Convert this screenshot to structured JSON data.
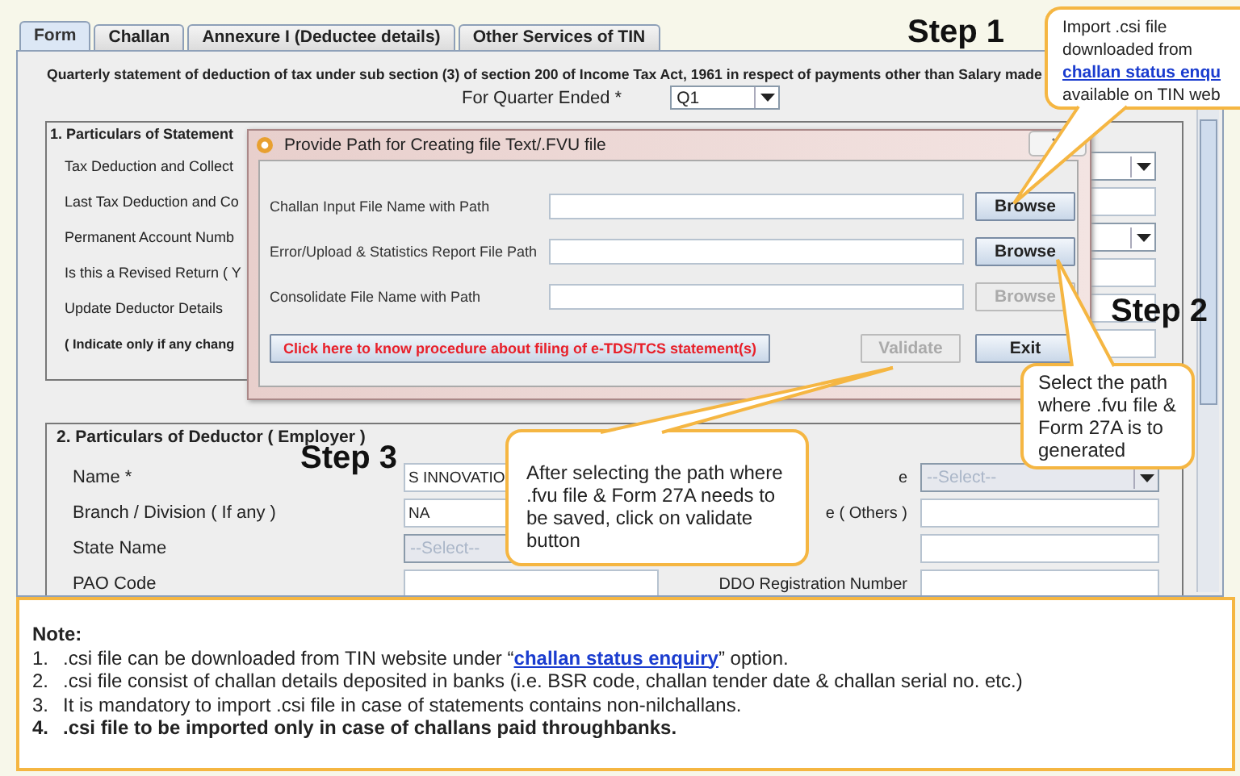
{
  "tabs": [
    {
      "label": "Form",
      "selected": true
    },
    {
      "label": "Challan",
      "selected": false
    },
    {
      "label": "Annexure I (Deductee details)",
      "selected": false
    },
    {
      "label": "Other Services of TIN",
      "selected": false
    }
  ],
  "form": {
    "heading": "Quarterly statement of deduction of tax under sub section (3) of section 200 of Income Tax Act, 1961 in respect of payments other than Salary made",
    "quarter_label": "For Quarter Ended *",
    "quarter_value": "Q1",
    "section_1": {
      "title": "1. Particulars of Statement",
      "rows": [
        {
          "label": "Tax Deduction and Collect",
          "bold": false,
          "kind": "dropdown"
        },
        {
          "label": "Last Tax Deduction and Co",
          "bold": false,
          "kind": "text"
        },
        {
          "label": "Permanent Account Numb",
          "bold": false,
          "kind": "dropdown"
        },
        {
          "label": "Is this a Revised Return ( Y",
          "bold": false,
          "kind": "text"
        },
        {
          "label": "Update Deductor Details",
          "bold": false,
          "kind": "text"
        },
        {
          "label": "( Indicate only if any chang",
          "bold": true,
          "kind": "text"
        }
      ]
    },
    "section_2": {
      "title": "2. Particulars of Deductor ( Employer )",
      "rows": [
        {
          "label": "Name *",
          "field": {
            "kind": "text",
            "value": "S INNOVATIO",
            "disabled": false
          },
          "right_label": "e",
          "right_field": {
            "kind": "dropdown",
            "value": "--Select--",
            "disabled": true
          }
        },
        {
          "label": "Branch / Division ( If any )",
          "field": {
            "kind": "text",
            "value": "NA",
            "disabled": false
          },
          "right_label": "e ( Others )",
          "right_field": {
            "kind": "text",
            "disabled": false
          }
        },
        {
          "label": "State Name",
          "field": {
            "kind": "dropdown",
            "value": "--Select--",
            "disabled": true
          },
          "right_field": {
            "kind": "text",
            "disabled": false
          }
        },
        {
          "label": "PAO Code",
          "field": {
            "kind": "text",
            "disabled": false
          },
          "right_label": "DDO Registration Number",
          "right_field": {
            "kind": "text",
            "disabled": false
          }
        }
      ]
    }
  },
  "dialog": {
    "title": "Provide Path for Creating file Text/.FVU file",
    "rows": [
      {
        "label": "Challan Input File Name with Path",
        "button": "Browse",
        "disabled": false
      },
      {
        "label": "Error/Upload & Statistics Report File Path",
        "button": "Browse",
        "disabled": false
      },
      {
        "label": "Consolidate File Name with Path",
        "button": "Browse",
        "disabled": true
      }
    ],
    "procedure_button": "Click here to know procedure about filing of e-TDS/TCS statement(s)",
    "validate": {
      "label": "Validate",
      "disabled": true
    },
    "exit": {
      "label": "Exit",
      "disabled": false
    }
  },
  "steps": [
    "Step 1",
    "Step 2",
    "Step 3"
  ],
  "callouts": [
    {
      "text": "Import .csi file downloaded from",
      "link": "challan status enqu",
      "text_after": "available on TIN web"
    },
    {
      "text": "Select the path where .fvu file & Form 27A is to generated"
    },
    {
      "text": "After selecting the path where .fvu file & Form 27A needs to be saved, click on validate button"
    }
  ],
  "note": {
    "title": "Note:",
    "items": [
      {
        "number": "1.",
        "text": ".csi file can be downloaded from TIN website under “",
        "link": "challan status enquiry",
        "text_after": "” option.",
        "bold": false
      },
      {
        "number": "2.",
        "text": ".csi file consist of challan details deposited in banks (i.e. BSR code, challan tender date & challan serial no. etc.)",
        "bold": false
      },
      {
        "number": "3.",
        "text": "It is mandatory to import .csi file in case of statements contains non-nilchallans.",
        "bold": false
      },
      {
        "number": "4.",
        "text": ".csi file to be imported only in case of challans paid throughbanks.",
        "bold": true
      }
    ]
  }
}
